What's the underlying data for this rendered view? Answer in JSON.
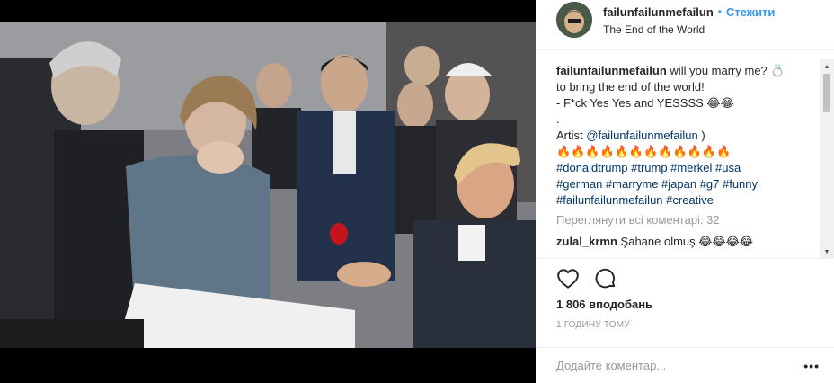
{
  "post": {
    "username": "failunfailunmefailun",
    "follow_label": "Стежити",
    "location": "The End of the World",
    "caption": {
      "username": "failunfailunmefailun",
      "line1": "will you marry me? 💍",
      "line2": "to bring the end of the world!",
      "line3": "- F*ck Yes Yes and YESSSS 😂😂",
      "line4": ".",
      "artist_prefix": "Artist",
      "artist_handle": "@failunfailunmefailun",
      "artist_suffix": ")",
      "emoji_line": "🔥🔥🔥🔥🔥🔥🔥🔥🔥🔥🔥🔥",
      "hashtags_line1": "#donaldtrump #trump #merkel #usa",
      "hashtags_line2": "#german #marryme #japan #g7 #funny",
      "hashtags_line3": "#failunfailunmefailun #creative"
    },
    "view_all": "Переглянути всі коментарі: 32",
    "comments": [
      {
        "username": "zulal_krmn",
        "text": "Şahane olmuş 😂😂😂😂"
      }
    ],
    "likes": "1 806 вподобань",
    "time": "1 годину тому",
    "add_comment_placeholder": "Додайте коментар...",
    "icons": {
      "like": "heart-icon",
      "comment": "comment-icon",
      "more": "more-options-icon",
      "scroll_up": "scroll-up-arrow",
      "scroll_down": "scroll-down-arrow"
    }
  }
}
